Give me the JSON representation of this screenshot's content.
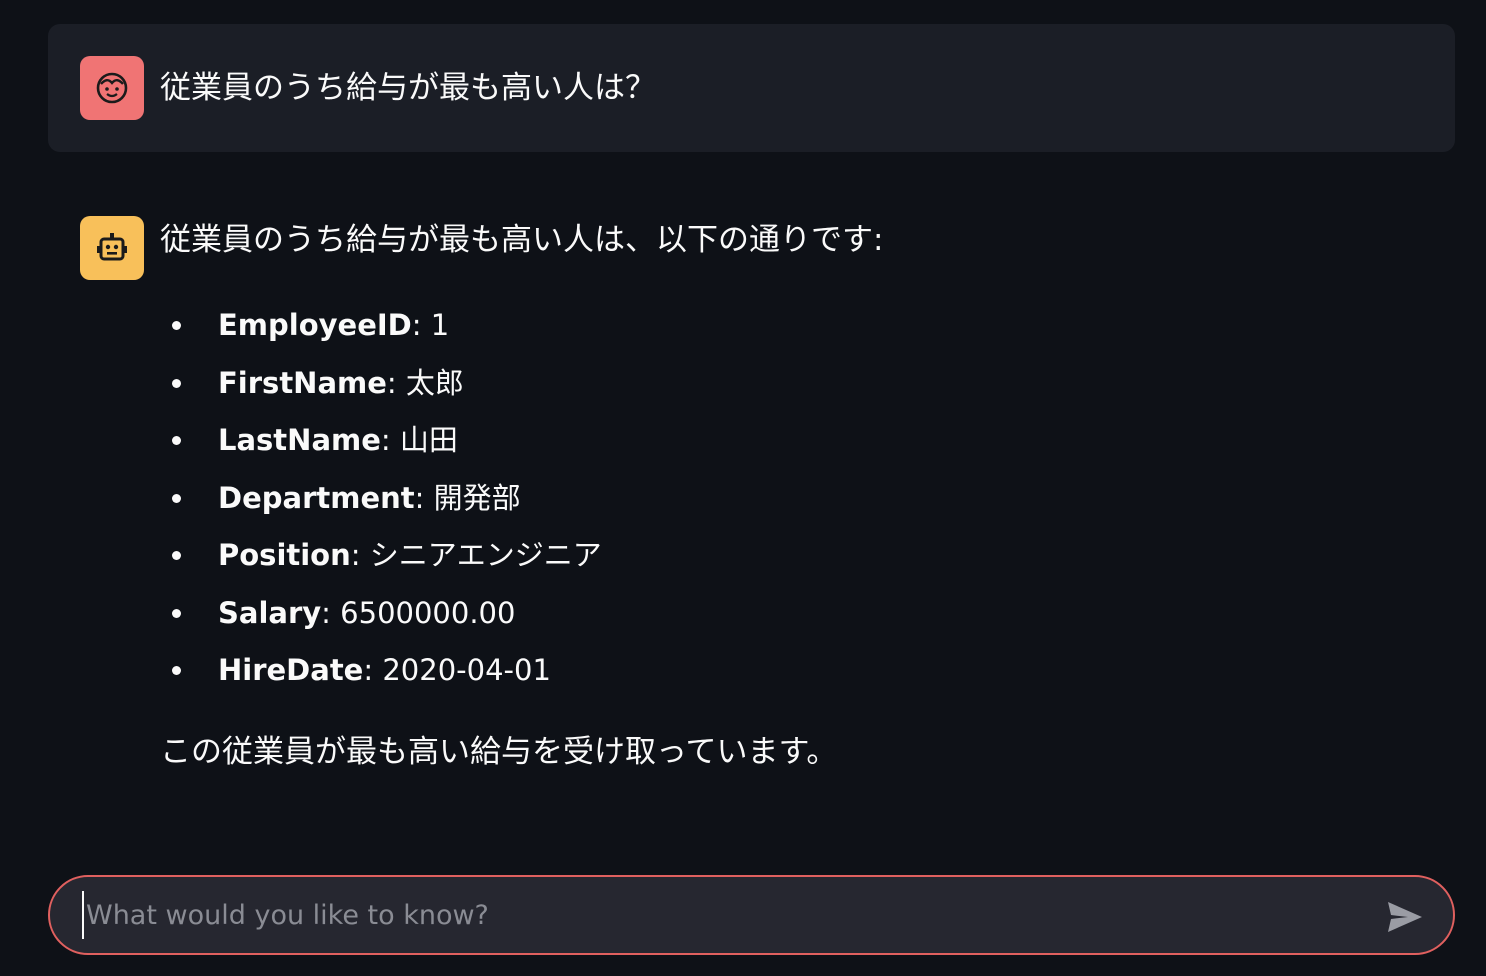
{
  "conversation": {
    "user_message": "従業員のうち給与が最も高い人は？",
    "user_avatar_icon": "smiley-face-icon",
    "bot_avatar_icon": "robot-face-icon",
    "bot_intro": "従業員のうち給与が最も高い人は、以下の通りです:",
    "details": [
      {
        "key": "EmployeeID",
        "value": " 1"
      },
      {
        "key": "FirstName",
        "value": " 太郎"
      },
      {
        "key": "LastName",
        "value": " 山田"
      },
      {
        "key": "Department",
        "value": " 開発部"
      },
      {
        "key": "Position",
        "value": " シニアエンジニア"
      },
      {
        "key": "Salary",
        "value": " 6500000.00"
      },
      {
        "key": "HireDate",
        "value": " 2020-04-01"
      }
    ],
    "bot_outro": "この従業員が最も高い給与を受け取っています。"
  },
  "chat_input": {
    "placeholder": "What would you like to know?",
    "value": "",
    "send_icon": "send-icon"
  },
  "colors": {
    "background": "#0e1117",
    "user_message_bg": "#1b1e26",
    "user_avatar": "#f07474",
    "bot_avatar": "#f8c05a",
    "input_border": "#e0605f"
  }
}
